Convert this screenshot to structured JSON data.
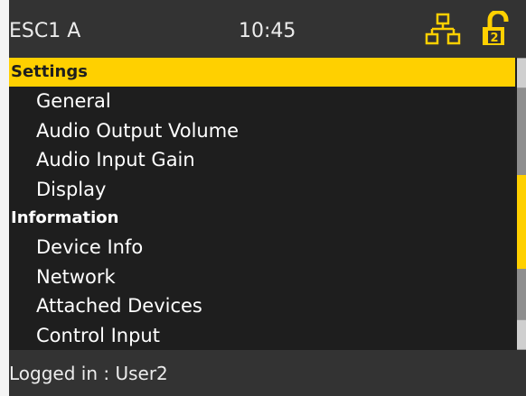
{
  "header": {
    "device_name": "ESC1 A",
    "time": "10:45",
    "network_icon": "network-icon",
    "lock_icon": "unlocked-padlock-icon",
    "lock_badge": "2",
    "icon_color": "#ffd000"
  },
  "menu": {
    "rows": [
      {
        "type": "header",
        "label": "Settings",
        "selected": true
      },
      {
        "type": "item",
        "label": "General"
      },
      {
        "type": "item",
        "label": "Audio Output Volume"
      },
      {
        "type": "item",
        "label": "Audio Input Gain"
      },
      {
        "type": "item",
        "label": "Display"
      },
      {
        "type": "header",
        "label": "Information"
      },
      {
        "type": "item",
        "label": "Device Info"
      },
      {
        "type": "item",
        "label": "Network"
      },
      {
        "type": "item",
        "label": "Attached Devices"
      },
      {
        "type": "item",
        "label": "Control Input"
      }
    ],
    "selection_color": "#ffd000"
  },
  "status": {
    "text": "Logged in : User2"
  }
}
